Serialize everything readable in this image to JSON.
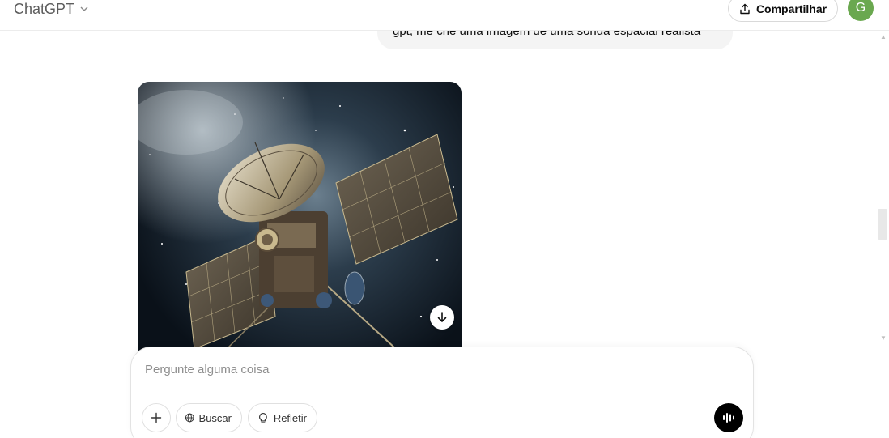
{
  "header": {
    "model_name": "ChatGPT",
    "share_label": "Compartilhar",
    "avatar_initial": "G",
    "avatar_color": "#6aa84f"
  },
  "conversation": {
    "user_message": "gpt, me crie uma imagem de uma sonda espacial realista",
    "assistant_image": {
      "subject": "realistic space probe",
      "download_icon": "arrow-down-icon"
    }
  },
  "composer": {
    "placeholder": "Pergunte alguma coisa",
    "value": "",
    "attach_icon": "plus-icon",
    "tools": [
      {
        "label": "Buscar",
        "icon": "globe-icon"
      },
      {
        "label": "Refletir",
        "icon": "lightbulb-icon"
      }
    ],
    "voice_icon": "voice-waveform-icon"
  }
}
